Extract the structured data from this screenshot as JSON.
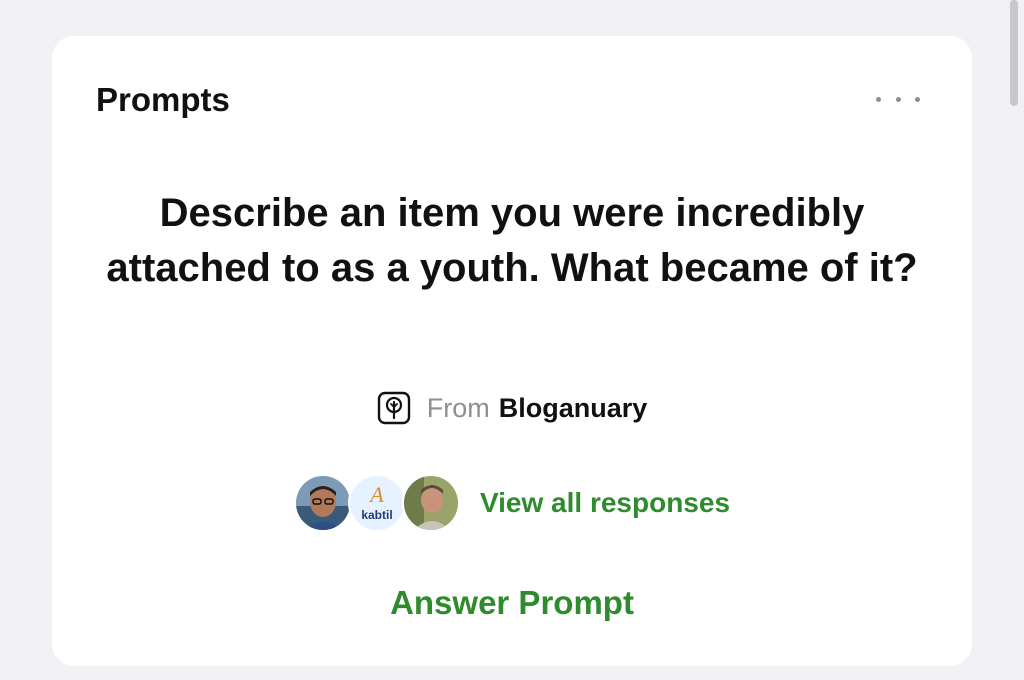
{
  "card": {
    "title": "Prompts",
    "more_icon": "more-horizontal-icon",
    "question": "Describe an item you were incredibly attached to as a youth. What became of it?",
    "source": {
      "icon": "bloganuary-icon",
      "from_label": "From",
      "name": "Bloganuary"
    },
    "responses": {
      "avatars": [
        {
          "name": "avatar-person-glasses"
        },
        {
          "name": "avatar-kabtil-logo",
          "logo_text": "kabtil",
          "logo_letter": "A"
        },
        {
          "name": "avatar-person-outdoor"
        }
      ],
      "link_label": "View all responses"
    },
    "answer_label": "Answer Prompt"
  },
  "colors": {
    "background": "#f0f0f5",
    "card": "#ffffff",
    "accent_green": "#2e8b2e",
    "muted_gray": "#8e8e93"
  }
}
